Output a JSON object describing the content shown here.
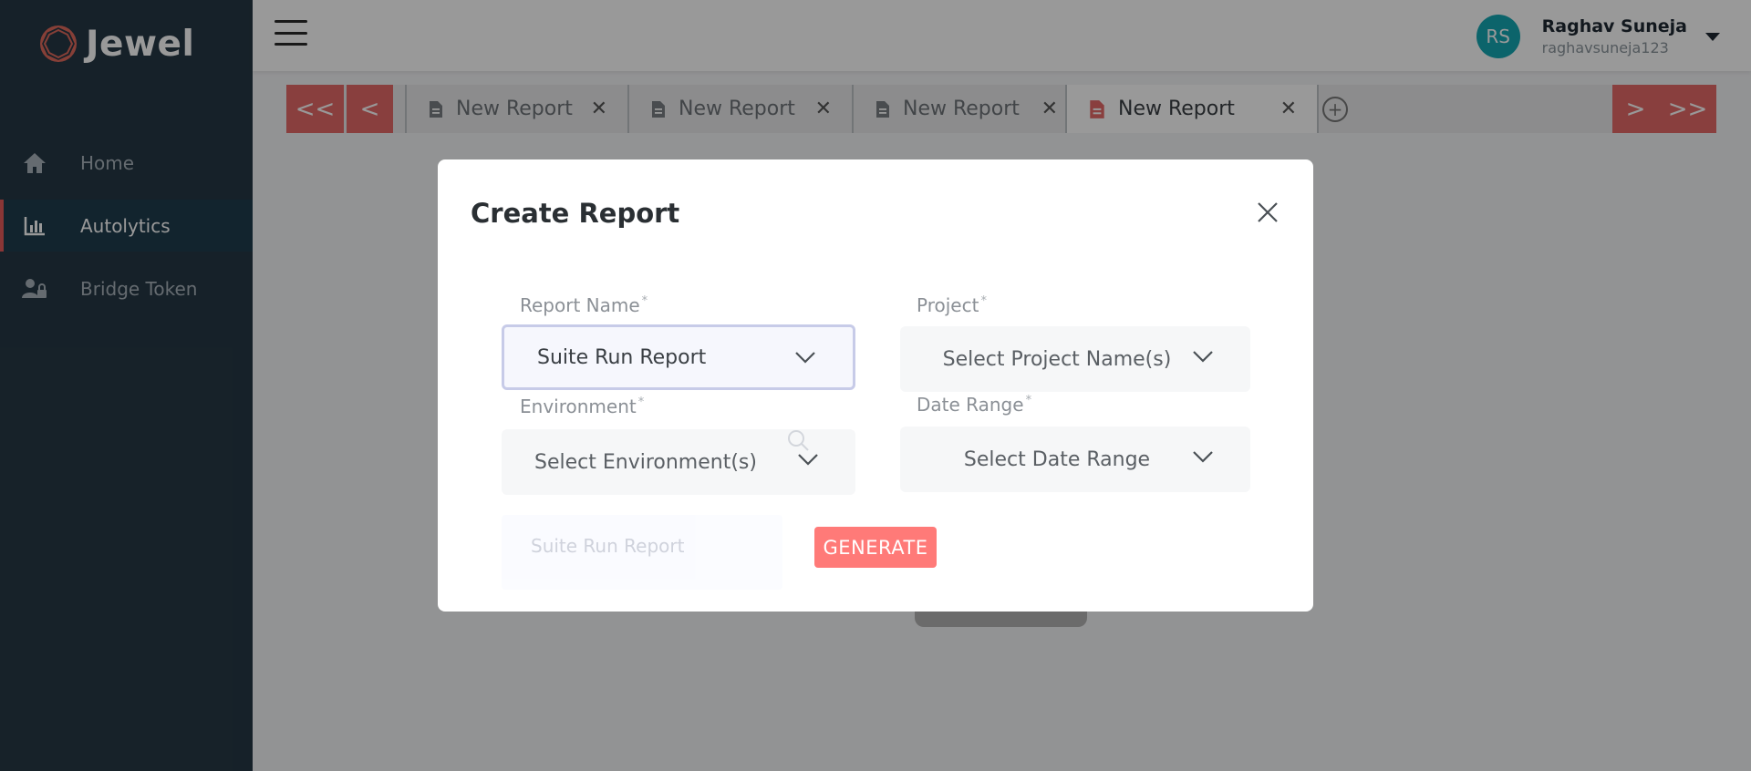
{
  "app": {
    "name": "Jewel",
    "brand_color": "#e65a5a"
  },
  "sidebar": {
    "items": [
      {
        "label": "Home",
        "icon": "home-icon",
        "active": false
      },
      {
        "label": "Autolytics",
        "icon": "bar-chart-icon",
        "active": true
      },
      {
        "label": "Bridge Token",
        "icon": "user-lock-icon",
        "active": false
      }
    ]
  },
  "header": {
    "user": {
      "initials": "RS",
      "name": "Raghav Suneja",
      "handle": "raghavsuneja123"
    }
  },
  "tabs": {
    "first_label": "<<",
    "prev_label": "<",
    "next_label": ">",
    "last_label": ">>",
    "items": [
      {
        "label": "New Report",
        "active": false
      },
      {
        "label": "New Report",
        "active": false
      },
      {
        "label": "New Report",
        "active": false
      },
      {
        "label": "New Report",
        "active": true
      }
    ],
    "add_label": "+"
  },
  "modal": {
    "title": "Create Report",
    "fields": {
      "report_name": {
        "label": "Report Name",
        "required": "*",
        "value": "Suite Run Report"
      },
      "project": {
        "label": "Project",
        "required": "*",
        "value": "Select Project Name(s)"
      },
      "environment": {
        "label": "Environment",
        "required": "*",
        "value": "Select Environment(s)"
      },
      "date_range": {
        "label": "Date Range",
        "required": "*",
        "value": "Select Date Range"
      }
    },
    "dropdown_option": "Suite Run Report",
    "generate_label": "GENERATE"
  }
}
